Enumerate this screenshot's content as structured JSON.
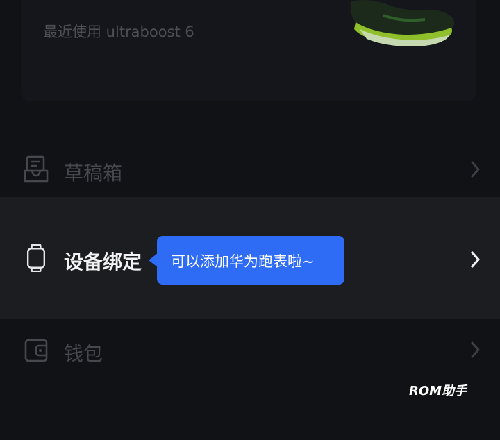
{
  "shoe_card": {
    "recent_text": "最近使用 ultraboost 6",
    "image_icon": "running-shoe-image"
  },
  "menu": {
    "drafts": {
      "label": "草稿箱",
      "icon": "draft-box-icon"
    },
    "device_binding": {
      "label": "设备绑定",
      "icon": "watch-icon"
    },
    "wallet": {
      "label": "钱包",
      "icon": "wallet-icon"
    }
  },
  "tooltip": {
    "text": "可以添加华为跑表啦~"
  },
  "watermark": {
    "text": "ROM助手"
  },
  "colors": {
    "background": "#111216",
    "highlight_row": "#1c1d21",
    "tooltip": "#2e6cf6",
    "dim_text": "#47484e",
    "bright_text": "#f2f2f4"
  }
}
